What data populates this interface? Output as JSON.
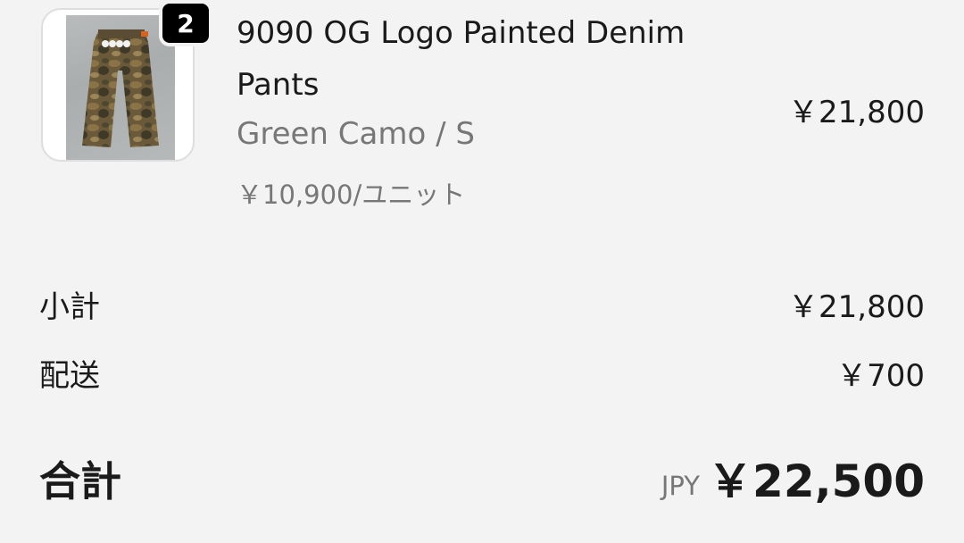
{
  "item": {
    "quantity_badge": "2",
    "name": "9090 OG Logo Painted Denim Pants",
    "variant": "Green Camo / S",
    "unit_price": "￥10,900/ユニット",
    "line_price": "￥21,800",
    "image_icon": "camo-pants-photo"
  },
  "summary": {
    "subtotal_label": "小計",
    "subtotal_value": "￥21,800",
    "shipping_label": "配送",
    "shipping_value": "￥700",
    "total_label": "合計",
    "currency": "JPY",
    "total_value": "￥22,500"
  }
}
